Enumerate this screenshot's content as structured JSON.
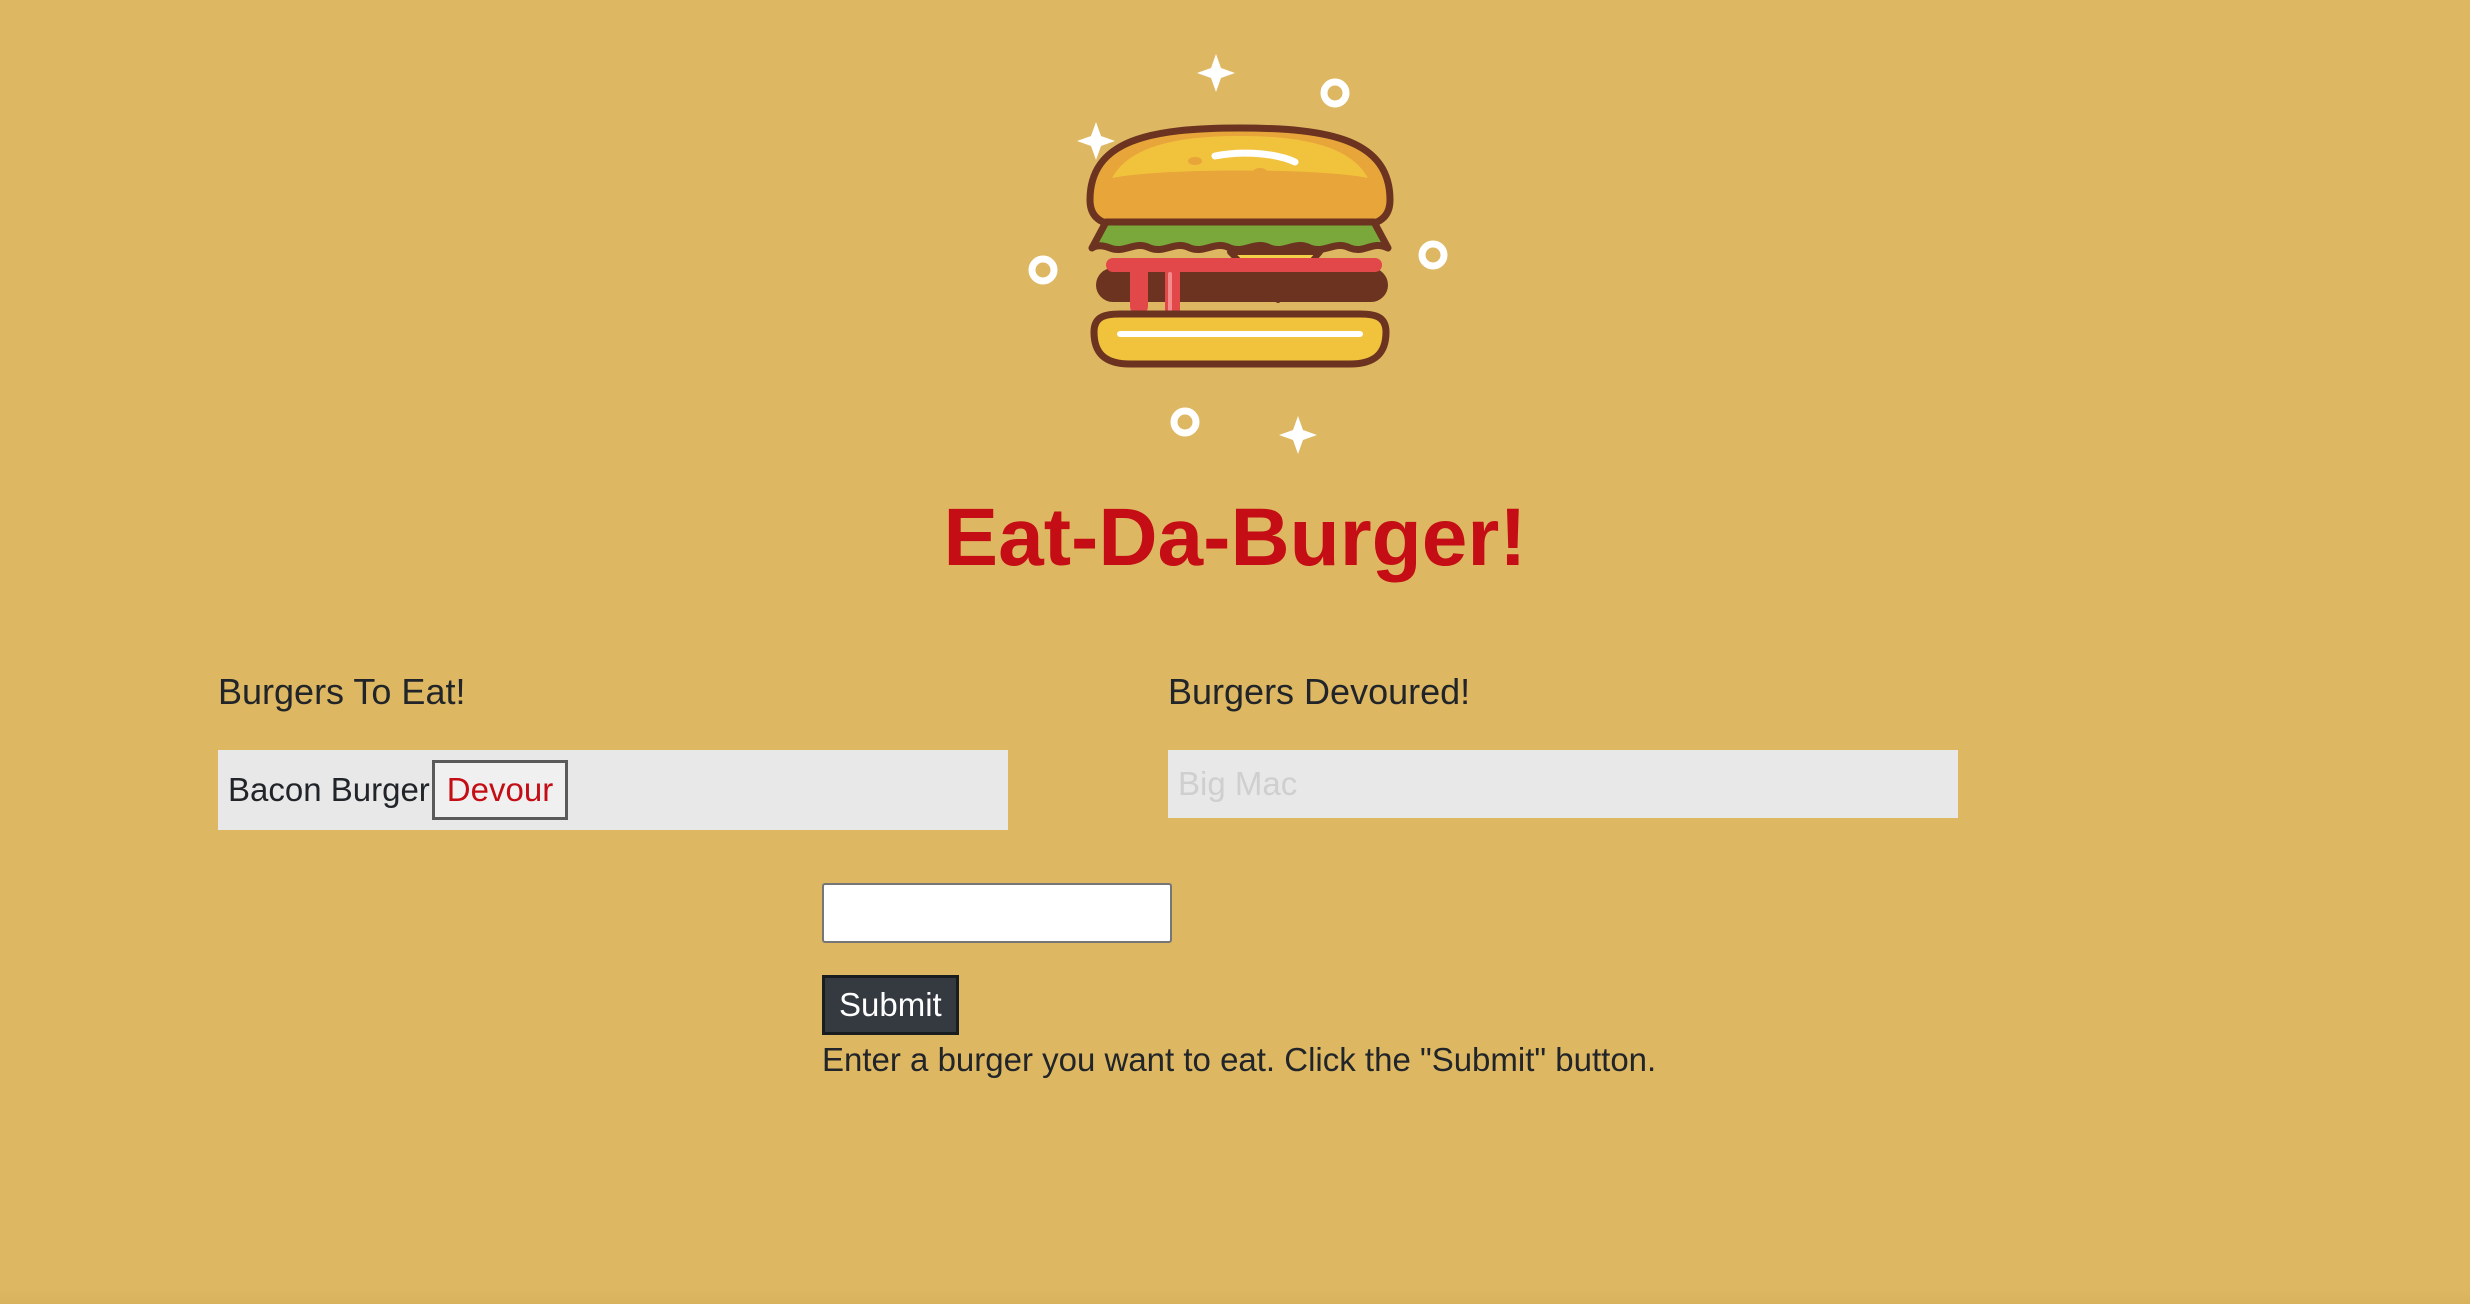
{
  "header": {
    "logo_icon": "burger-icon",
    "title": "Eat-Da-Burger!"
  },
  "columns": {
    "to_eat_heading": "Burgers To Eat!",
    "devoured_heading": "Burgers Devoured!"
  },
  "to_eat": [
    {
      "name": "Bacon Burger",
      "button_label": "Devour"
    }
  ],
  "devoured": [
    {
      "name": "Big Mac"
    }
  ],
  "form": {
    "input_value": "",
    "submit_label": "Submit",
    "helper_text": "Enter a burger you want to eat. Click the \"Submit\" button."
  },
  "colors": {
    "background": "#ddb761",
    "title": "#c40d14",
    "devour_text": "#c40d14",
    "submit_bg": "#343a40",
    "list_bg": "#e8e8e8"
  }
}
